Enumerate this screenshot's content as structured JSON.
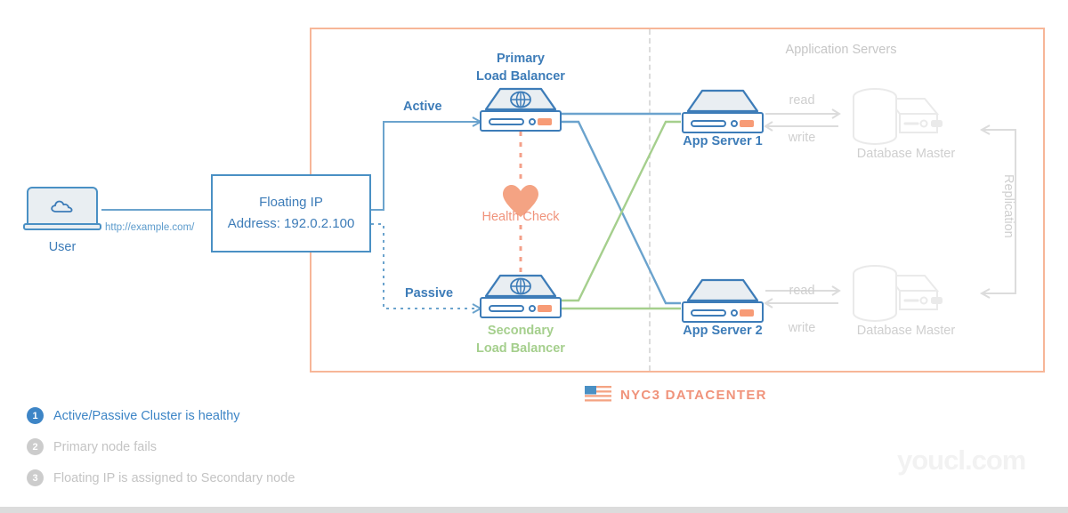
{
  "colors": {
    "blue": "#3d7cb8",
    "blue_line": "#6ba3cd",
    "green": "#a5cf8d",
    "salmon": "#f0937b",
    "salmon_border": "#f7b698",
    "gray_muted": "#d6d6d6",
    "orange_led": "#f79b76"
  },
  "user": {
    "label": "User",
    "url": "http://example.com/",
    "icon": "cloud-icon"
  },
  "floating_ip": {
    "line1": "Floating IP",
    "line2": "Address: 192.0.2.100"
  },
  "paths": {
    "active_label": "Active",
    "passive_label": "Passive"
  },
  "load_balancers": {
    "primary": {
      "title_line1": "Primary",
      "title_line2": "Load Balancer",
      "icon": "load-balancer-icon"
    },
    "secondary": {
      "title_line1": "Secondary",
      "title_line2": "Load Balancer",
      "icon": "load-balancer-icon"
    }
  },
  "health_check": {
    "label": "Health Check",
    "icon": "heart-icon"
  },
  "app_servers": {
    "section_title": "Application Servers",
    "server1": {
      "label": "App Server 1",
      "icon": "server-icon"
    },
    "server2": {
      "label": "App Server 2",
      "icon": "server-icon"
    }
  },
  "databases": {
    "master1": {
      "label": "Database Master",
      "icon": "database-icon"
    },
    "master2": {
      "label": "Database Master",
      "icon": "database-icon"
    },
    "read_label_1": "read",
    "write_label_1": "write",
    "read_label_2": "read",
    "write_label_2": "write",
    "replication_label": "Replication"
  },
  "legend": {
    "items": [
      {
        "num": "1",
        "text": "Active/Passive Cluster is healthy",
        "active": true
      },
      {
        "num": "2",
        "text": "Primary node fails",
        "active": false
      },
      {
        "num": "3",
        "text": "Floating IP is assigned to Secondary node",
        "active": false
      }
    ]
  },
  "datacenter": {
    "name": "NYC3 DATACENTER",
    "flag_icon": "us-flag-icon"
  },
  "watermark": {
    "text": "youcl.com"
  }
}
